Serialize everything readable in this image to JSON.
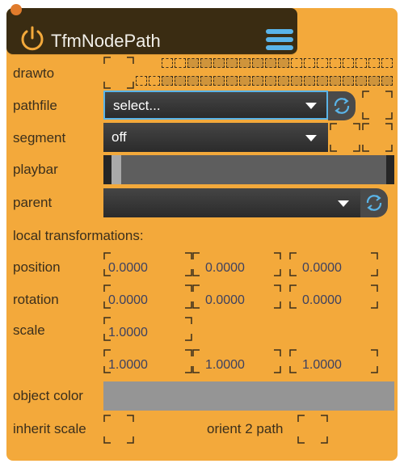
{
  "header": {
    "title": "TfmNodePath"
  },
  "labels": {
    "drawto": "drawto",
    "pathfile": "pathfile",
    "segment": "segment",
    "playbar": "playbar",
    "parent": "parent",
    "local_transformations": "local transformations:",
    "position": "position",
    "rotation": "rotation",
    "scale": "scale",
    "object_color": "object color",
    "inherit_scale": "inherit scale",
    "orient_2_path": "orient 2 path"
  },
  "pathfile": {
    "value": "select..."
  },
  "segment": {
    "value": "off"
  },
  "parent": {
    "value": ""
  },
  "position": {
    "x": "0.0000",
    "y": "0.0000",
    "z": "0.0000"
  },
  "rotation": {
    "x": "0.0000",
    "y": "0.0000",
    "z": "0.0000"
  },
  "scale": {
    "uniform": "1.0000",
    "x": "1.0000",
    "y": "1.0000",
    "z": "1.0000"
  },
  "playbar": {
    "position": 0.0
  },
  "colors": {
    "panel": "#f3a93b",
    "header": "#3a2c12",
    "accent": "#5ab4e8",
    "object_color": "#959595"
  }
}
